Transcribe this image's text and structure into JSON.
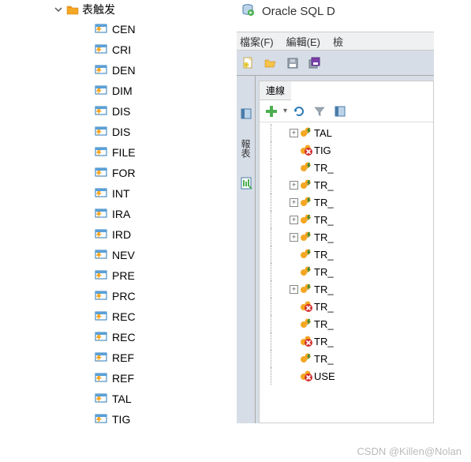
{
  "left": {
    "folder_label": "表触发",
    "items": [
      "CEN",
      "CRI",
      "DEN",
      "DIM",
      "DIS",
      "DIS",
      "FILE",
      "FOR",
      "INT",
      "IRA",
      "IRD",
      "NEV",
      "PRE",
      "PRC",
      "REC",
      "REC",
      "REF",
      "REF",
      "TAL",
      "TIG"
    ]
  },
  "right": {
    "title": "Oracle SQL D",
    "menu": {
      "file": "檔案(F)",
      "edit": "編輯(E)",
      "view": "檢"
    },
    "tab_label": "連線",
    "side_tab": "報表",
    "tree": [
      {
        "exp": "+",
        "status": "ok",
        "label": "TAL"
      },
      {
        "exp": "",
        "status": "err",
        "label": "TIG"
      },
      {
        "exp": "",
        "status": "ok",
        "label": "TR_"
      },
      {
        "exp": "+",
        "status": "ok",
        "label": "TR_"
      },
      {
        "exp": "+",
        "status": "ok",
        "label": "TR_"
      },
      {
        "exp": "+",
        "status": "ok",
        "label": "TR_"
      },
      {
        "exp": "+",
        "status": "ok",
        "label": "TR_"
      },
      {
        "exp": "",
        "status": "ok",
        "label": "TR_"
      },
      {
        "exp": "",
        "status": "ok",
        "label": "TR_"
      },
      {
        "exp": "+",
        "status": "ok",
        "label": "TR_"
      },
      {
        "exp": "",
        "status": "err",
        "label": "TR_"
      },
      {
        "exp": "",
        "status": "ok",
        "label": "TR_"
      },
      {
        "exp": "",
        "status": "err",
        "label": "TR_"
      },
      {
        "exp": "",
        "status": "ok",
        "label": "TR_"
      },
      {
        "exp": "",
        "status": "err",
        "label": "USE"
      }
    ]
  },
  "watermark": "CSDN @Killen@Nolan"
}
